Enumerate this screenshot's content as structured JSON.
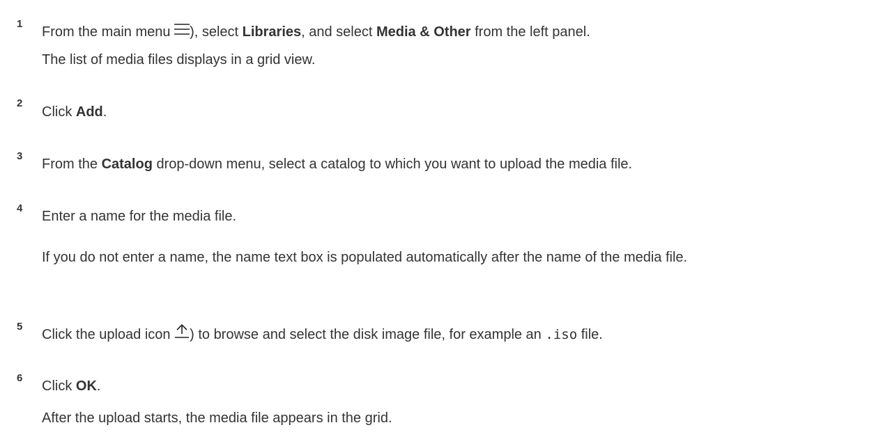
{
  "steps": [
    {
      "number": "1",
      "line1": {
        "t1": "From the main menu ",
        "icon": "hamburger-menu-icon",
        "t2": "), select ",
        "b1": "Libraries",
        "t3": ", and select ",
        "b2": "Media & Other",
        "t4": " from the left panel."
      },
      "result": "The list of media files displays in a grid view."
    },
    {
      "number": "2",
      "line1": {
        "t1": "Click ",
        "b1": "Add",
        "t2": "."
      }
    },
    {
      "number": "3",
      "line1": {
        "t1": "From the ",
        "b1": "Catalog",
        "t2": " drop-down menu, select a catalog to which you want to upload the media file."
      }
    },
    {
      "number": "4",
      "line1": {
        "t1": "Enter a name for the media file."
      },
      "note": "If you do not enter a name, the name text box is populated automatically after the name of the media file."
    },
    {
      "number": "5",
      "line1": {
        "t1": "Click the upload icon ",
        "icon": "upload-icon",
        "t2": ") to browse and select the disk image file, for example an ",
        "code": ".iso",
        "t3": " file."
      }
    },
    {
      "number": "6",
      "line1": {
        "t1": "Click ",
        "b1": "OK",
        "t2": "."
      },
      "result": "After the upload starts, the media file appears in the grid."
    }
  ]
}
